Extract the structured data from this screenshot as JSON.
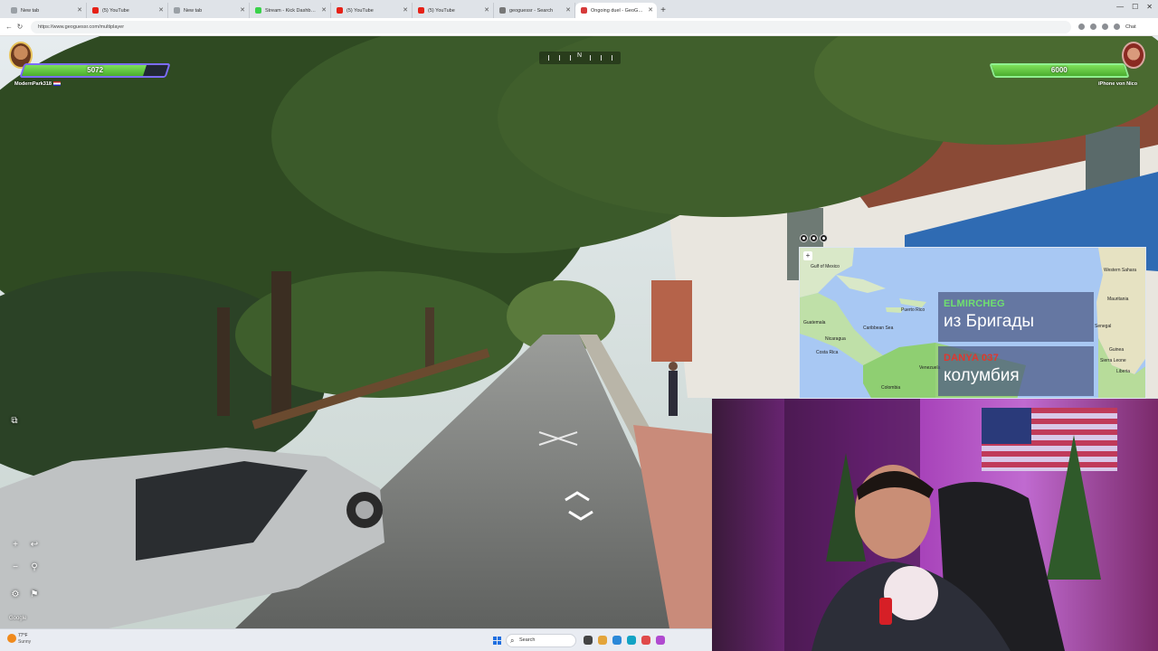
{
  "browser": {
    "tabs": [
      {
        "label": "New tab",
        "favicon": "chrome-tab-icon",
        "color": "#9aa0a6",
        "active": false
      },
      {
        "label": "(5) YouTube",
        "favicon": "youtube-icon",
        "color": "#e62117",
        "active": false
      },
      {
        "label": "New tab",
        "favicon": "chrome-tab-icon",
        "color": "#9aa0a6",
        "active": false
      },
      {
        "label": "Stream - Kick Dashboard",
        "favicon": "kick-icon",
        "color": "#3ad24a",
        "active": false
      },
      {
        "label": "(5) YouTube",
        "favicon": "youtube-icon",
        "color": "#e62117",
        "active": false
      },
      {
        "label": "(5) YouTube",
        "favicon": "youtube-icon",
        "color": "#e62117",
        "active": false
      },
      {
        "label": "geoguessr - Search",
        "favicon": "search-icon",
        "color": "#777777",
        "active": false
      },
      {
        "label": "Ongoing duel - GeoGuessr",
        "favicon": "geoguessr-icon",
        "color": "#d63a3a",
        "active": true
      }
    ],
    "url": "https://www.geoguessr.com/multiplayer",
    "chat_label": "Chat"
  },
  "game": {
    "player_left": {
      "name": "ModernPark318",
      "health": 5072,
      "max_health": 6000
    },
    "player_right": {
      "name": "iPhone von Nico",
      "health": 6000,
      "max_health": 6000
    },
    "compass_heading": "N",
    "attribution": "Google"
  },
  "map": {
    "labels": [
      {
        "text": "Gulf of Mexico",
        "cls": "gulf"
      },
      {
        "text": "Guatemala",
        "cls": "gua"
      },
      {
        "text": "Nicaragua",
        "cls": "nic"
      },
      {
        "text": "Costa Rica",
        "cls": "cr"
      },
      {
        "text": "Caribbean Sea",
        "cls": "cs"
      },
      {
        "text": "Puerto Rico",
        "cls": "pr"
      },
      {
        "text": "Venezuela",
        "cls": "ve"
      },
      {
        "text": "Colombia",
        "cls": "co"
      },
      {
        "text": "Western Sahara",
        "cls": "ws"
      },
      {
        "text": "Mauritania",
        "cls": "mr"
      },
      {
        "text": "Senegal",
        "cls": "sn"
      },
      {
        "text": "Guinea",
        "cls": "gn"
      },
      {
        "text": "Sierra Leone",
        "cls": "sl"
      },
      {
        "text": "Liberia",
        "cls": "lr"
      }
    ]
  },
  "chat": {
    "messages": [
      {
        "user": "ELMIRCHEG",
        "user_color": "#6fe06f",
        "text": "из Бригады"
      },
      {
        "user": "DANYA 037",
        "user_color": "#e0372f",
        "text": "колумбия"
      }
    ]
  },
  "taskbar": {
    "weather_temp": "77°F",
    "weather_desc": "Sunny",
    "search_placeholder": "Search"
  },
  "colors": {
    "accent": "#7c6cff",
    "health": "#5ec43a"
  }
}
